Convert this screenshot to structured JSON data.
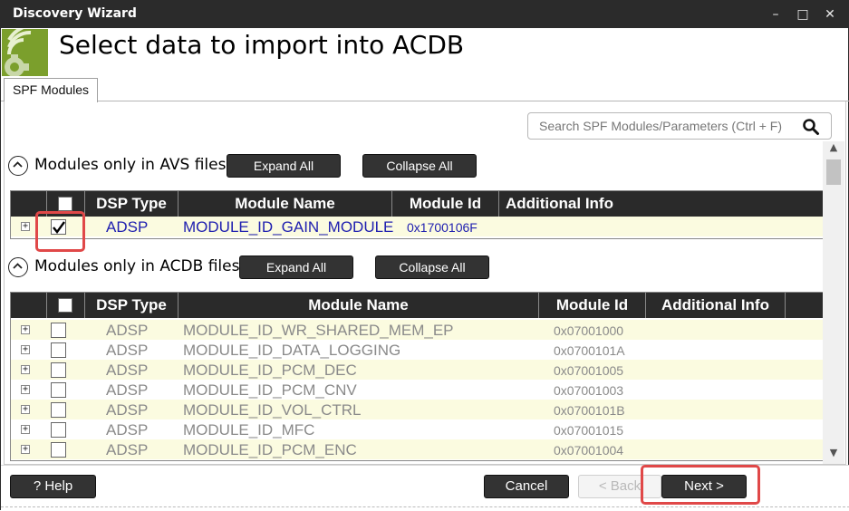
{
  "window": {
    "title": "Discovery Wizard",
    "controls": {
      "minimize": "–",
      "maximize": "□",
      "close": "✕"
    }
  },
  "header": {
    "heading": "Select data to import into ACDB"
  },
  "tabs": [
    {
      "label": "SPF Modules"
    }
  ],
  "search": {
    "placeholder": "Search SPF Modules/Parameters (Ctrl + F)"
  },
  "sections": {
    "avs": {
      "label": "Modules only in AVS files",
      "expand_all": "Expand All",
      "collapse_all": "Collapse All",
      "columns": [
        "DSP Type",
        "Module Name",
        "Module Id",
        "Additional Info"
      ],
      "rows": [
        {
          "dsp_type": "ADSP",
          "module_name": "MODULE_ID_GAIN_MODULE",
          "module_id": "0x1700106F",
          "additional_info": "",
          "checked": true
        }
      ]
    },
    "acdb": {
      "label": "Modules only in ACDB files",
      "expand_all": "Expand All",
      "collapse_all": "Collapse All",
      "columns": [
        "DSP Type",
        "Module Name",
        "Module Id",
        "Additional Info"
      ],
      "rows": [
        {
          "dsp_type": "ADSP",
          "module_name": "MODULE_ID_WR_SHARED_MEM_EP",
          "module_id": "0x07001000",
          "additional_info": ""
        },
        {
          "dsp_type": "ADSP",
          "module_name": "MODULE_ID_DATA_LOGGING",
          "module_id": "0x0700101A",
          "additional_info": ""
        },
        {
          "dsp_type": "ADSP",
          "module_name": "MODULE_ID_PCM_DEC",
          "module_id": "0x07001005",
          "additional_info": ""
        },
        {
          "dsp_type": "ADSP",
          "module_name": "MODULE_ID_PCM_CNV",
          "module_id": "0x07001003",
          "additional_info": ""
        },
        {
          "dsp_type": "ADSP",
          "module_name": "MODULE_ID_VOL_CTRL",
          "module_id": "0x0700101B",
          "additional_info": ""
        },
        {
          "dsp_type": "ADSP",
          "module_name": "MODULE_ID_MFC",
          "module_id": "0x07001015",
          "additional_info": ""
        },
        {
          "dsp_type": "ADSP",
          "module_name": "MODULE_ID_PCM_ENC",
          "module_id": "0x07001004",
          "additional_info": ""
        }
      ]
    }
  },
  "footer": {
    "help": "? Help",
    "cancel": "Cancel",
    "back": "< Back",
    "next": "Next >"
  },
  "colors": {
    "accent_logo": "#7b9f2c",
    "highlight_box": "#e04848",
    "row_alt": "#fbfbe0",
    "link_blue": "#2020b0"
  }
}
